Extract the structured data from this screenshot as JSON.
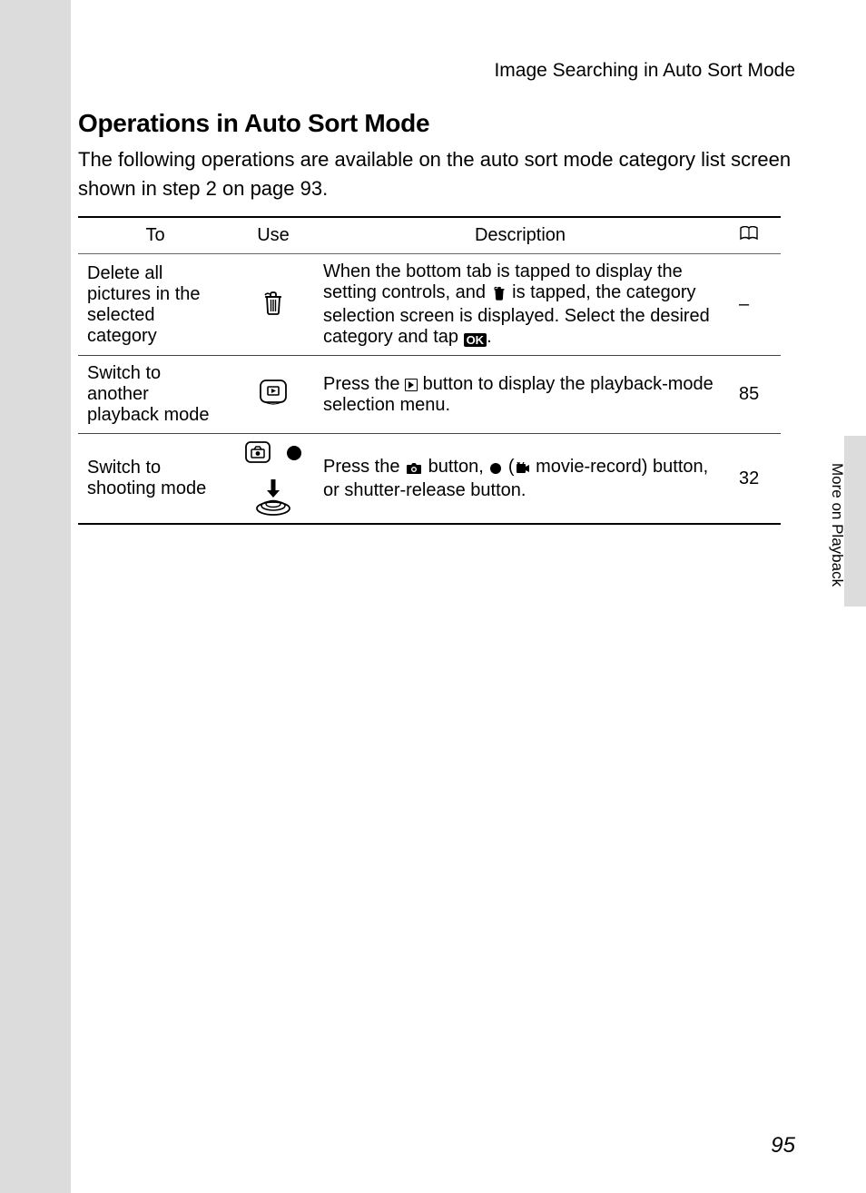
{
  "header": {
    "breadcrumb": "Image Searching in Auto Sort Mode"
  },
  "section": {
    "title": "Operations in Auto Sort Mode",
    "intro": "The following operations are available on the auto sort mode category list screen shown in step 2 on page 93."
  },
  "table": {
    "headers": {
      "to": "To",
      "use": "Use",
      "desc": "Description",
      "ref_icon": "book-icon"
    },
    "rows": [
      {
        "to": "Delete all pictures in the selected category",
        "use_icon": "trash-icon",
        "desc_parts": {
          "a": "When the bottom tab is tapped to display the setting controls, and ",
          "b": " is tapped, the category selection screen is displayed. Select the desired category and tap ",
          "c": "."
        },
        "ok_label": "OK",
        "ref": "–"
      },
      {
        "to": "Switch to another playback mode",
        "use_icon": "playback-button-icon",
        "desc_parts": {
          "a": "Press the ",
          "b": " button to display the playback-mode selection menu."
        },
        "ref": "85"
      },
      {
        "to": "Switch to shooting mode",
        "use_icons": [
          "camera-button-icon",
          "record-dot-icon",
          "shutter-press-icon"
        ],
        "desc_parts": {
          "a": "Press the ",
          "b": " button, ",
          "c": " (",
          "d": " movie-record) button, or shutter-release button."
        },
        "ref": "32"
      }
    ]
  },
  "side": {
    "label": "More on Playback"
  },
  "page": {
    "number": "95"
  }
}
